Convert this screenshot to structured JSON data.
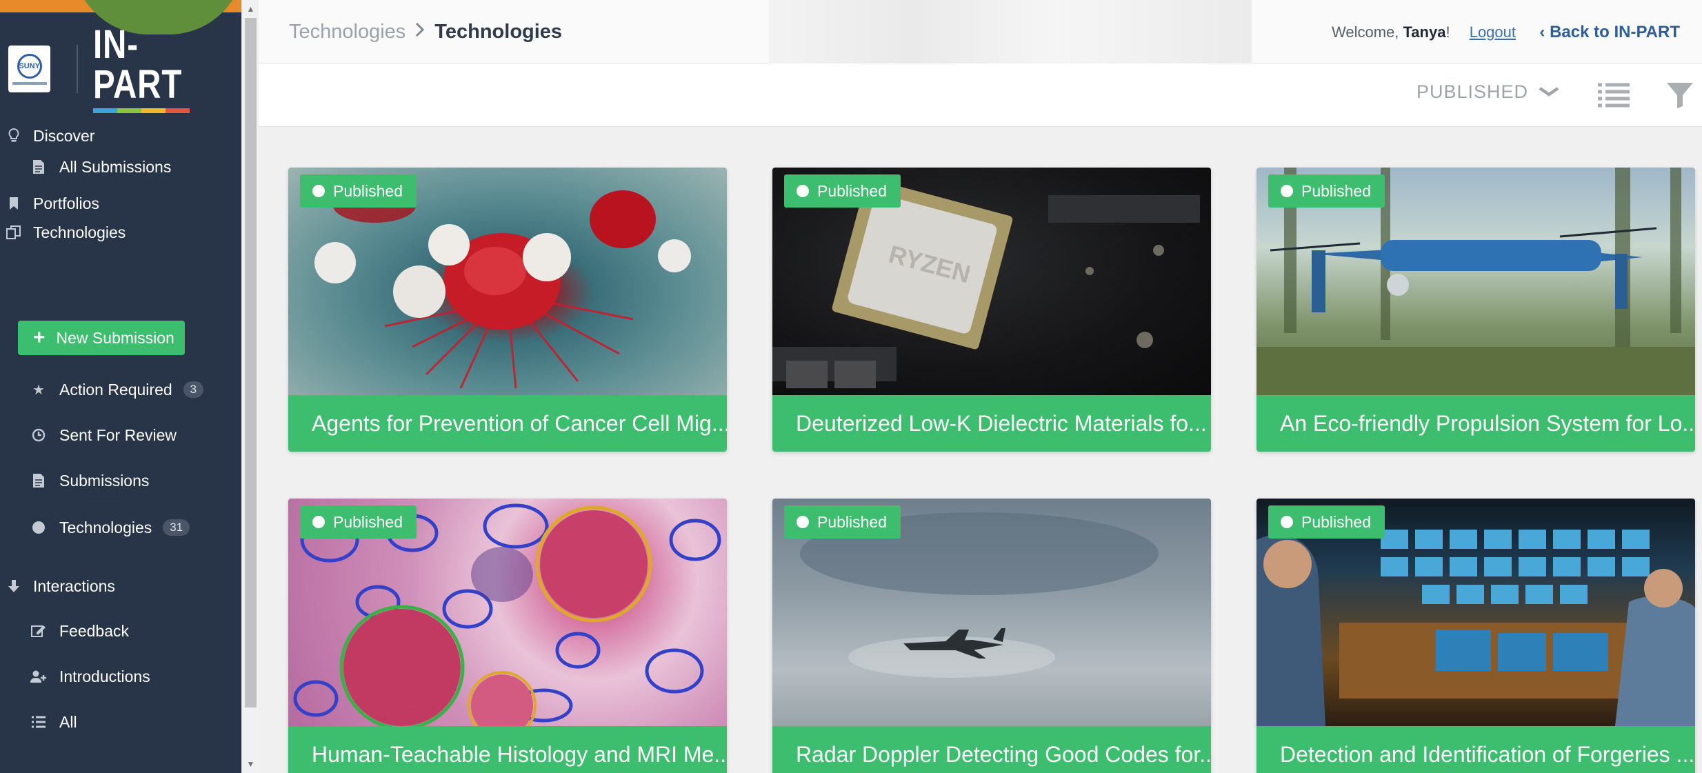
{
  "sidebar": {
    "logo_suny": "SUNY",
    "logo_inpart": "IN-PART",
    "logo_bar_colors": [
      "#3aa5d9",
      "#8fc43f",
      "#f2b632",
      "#e0583b"
    ],
    "nav": {
      "discover": "Discover",
      "all_submissions": "All Submissions",
      "portfolios": "Portfolios",
      "technologies": "Technologies",
      "new_submission": "New Submission",
      "action_required": "Action Required",
      "action_required_count": "3",
      "sent_for_review": "Sent For Review",
      "submissions": "Submissions",
      "technologies_sub": "Technologies",
      "technologies_count": "31",
      "interactions": "Interactions",
      "feedback": "Feedback",
      "introductions": "Introductions",
      "all": "All"
    }
  },
  "header": {
    "breadcrumb_first": "Technologies",
    "breadcrumb_current": "Technologies",
    "welcome_prefix": "Welcome, ",
    "user_name": "Tanya",
    "welcome_suffix": "!",
    "logout": "Logout",
    "back_link": "‹ Back to IN-PART"
  },
  "toolbar": {
    "status_value": "PUBLISHED"
  },
  "cards": [
    {
      "badge": "Published",
      "title": "Agents for Prevention of Cancer Cell Mig..."
    },
    {
      "badge": "Published",
      "title": "Deuterized Low-K Dielectric Materials fo..."
    },
    {
      "badge": "Published",
      "title": "An Eco-friendly Propulsion System for Lo..."
    },
    {
      "badge": "Published",
      "title": "Human-Teachable Histology and MRI Me..."
    },
    {
      "badge": "Published",
      "title": "Radar Doppler Detecting Good Codes for..."
    },
    {
      "badge": "Published",
      "title": "Detection and Identification of Forgeries ..."
    }
  ],
  "card_images": {
    "chip_text": "RYZEN"
  },
  "colors": {
    "accent_green": "#3dbd6e",
    "sidebar_bg": "#283447",
    "link_blue": "#2c5e9c"
  }
}
